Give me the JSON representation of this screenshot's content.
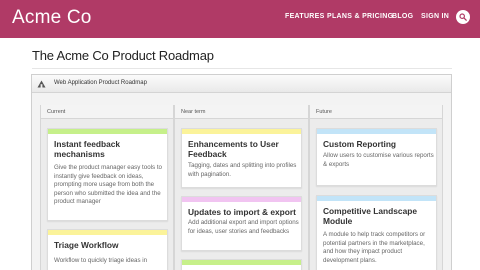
{
  "header": {
    "brand": "Acme Co",
    "nav": [
      "FEATURES",
      "PLANS & PRICING",
      "BLOG",
      "SIGN IN"
    ],
    "search_icon": "search-icon",
    "bar_color": "#b03a66"
  },
  "page": {
    "title": "The Acme Co Product Roadmap"
  },
  "board": {
    "title": "Web Application Product Roadmap",
    "icon": "roadmap-icon",
    "columns": [
      {
        "label": "Current",
        "cards": [
          {
            "title": "Instant feedback mechanisms",
            "color": "#c6f08a",
            "desc": "Give the product manager easy tools to instantly give feedback on ideas, prompting more usage from both the person who submitted the idea and the product manager"
          },
          {
            "title": "Triage Workflow",
            "color": "#fbf39a",
            "desc": "Workflow to quickly triage ideas in"
          }
        ]
      },
      {
        "label": "Near term",
        "cards": [
          {
            "title": "Enhancements to User Feedback",
            "color": "#fbf39a",
            "desc": "Tagging, dates and splitting into profiles with pagination."
          },
          {
            "title": "Updates to import & export",
            "color": "#f1c4f1",
            "desc": "Add additional export and import options for ideas, user stories and feedbacks"
          },
          {
            "title": "",
            "color": "#c6f08a",
            "desc": ""
          }
        ]
      },
      {
        "label": "Future",
        "cards": [
          {
            "title": "Custom Reporting",
            "color": "#c2e4f8",
            "desc": "Allow users to customise various reports & exports"
          },
          {
            "title": "Competitive Landscape Module",
            "color": "#c2e4f8",
            "desc": "A module to help track competitors or potential partners in the marketplace, and how they impact product development plans."
          }
        ]
      }
    ]
  }
}
